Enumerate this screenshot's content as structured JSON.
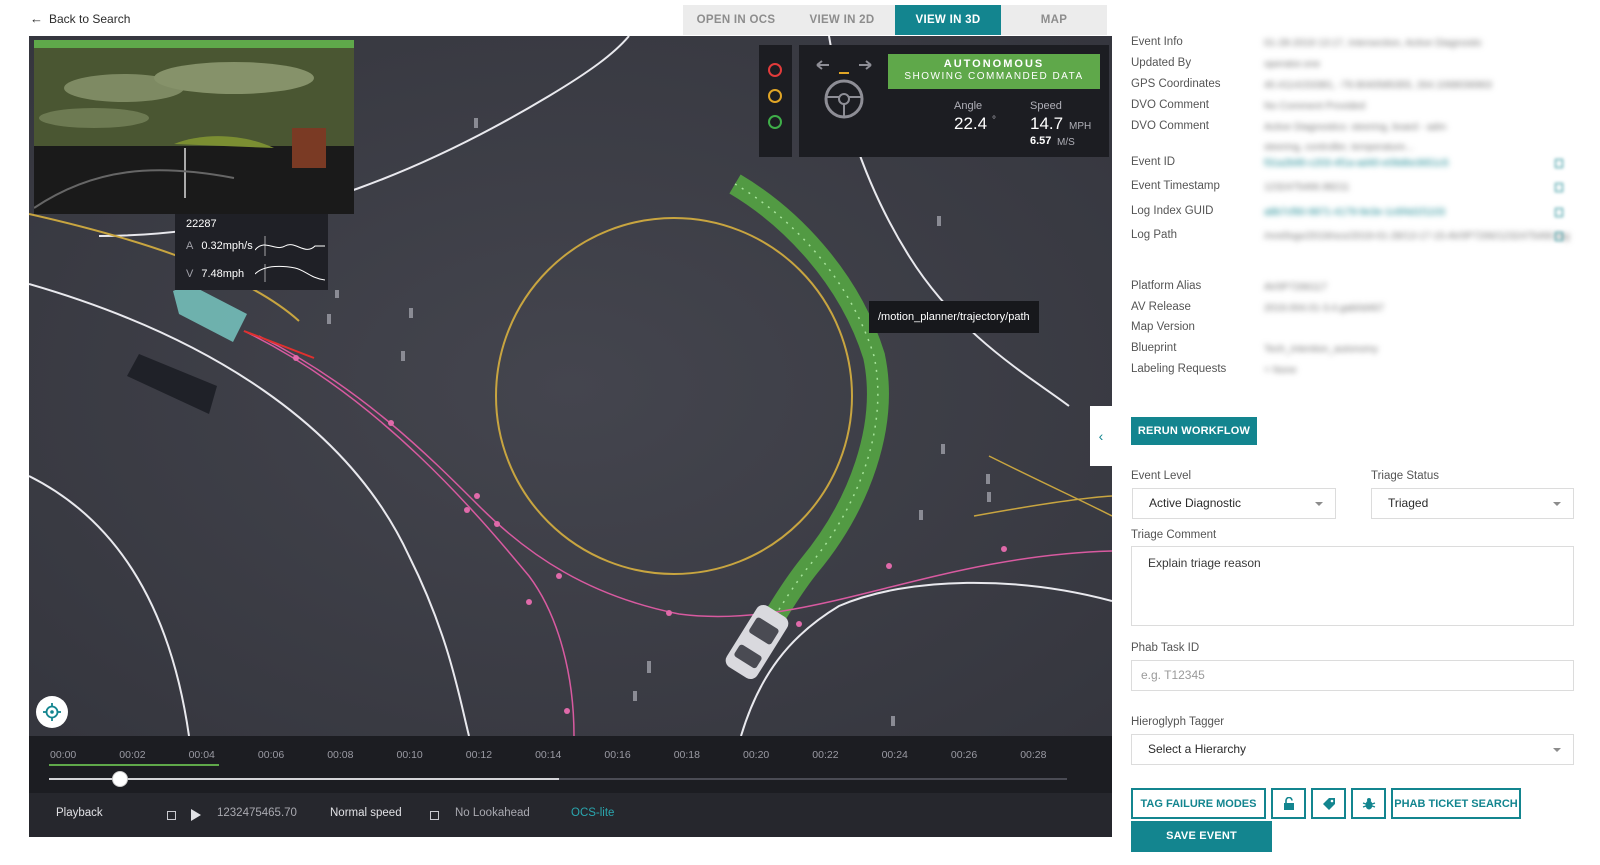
{
  "nav": {
    "back_label": "Back to Search",
    "tabs": [
      {
        "label": "OPEN IN OCS",
        "active": false
      },
      {
        "label": "VIEW IN 2D",
        "active": false
      },
      {
        "label": "VIEW IN 3D",
        "active": true
      },
      {
        "label": "MAP",
        "active": false
      }
    ]
  },
  "map": {
    "metrics": {
      "title": "22287",
      "accel_key": "A",
      "accel_value": "0.32mph/s",
      "velocity_key": "V",
      "velocity_value": "7.48mph"
    },
    "traffic_light": {
      "red": "#e23b3b",
      "yellow": "#e0a526",
      "green": "#3fae49"
    },
    "av_status": {
      "mode": "AUTONOMOUS",
      "mode_sub": "SHOWING COMMANDED DATA",
      "angle_label": "Angle",
      "angle_value": "22.4",
      "angle_unit": "°",
      "speed_label": "Speed",
      "speed_value": "14.7",
      "speed_unit": "MPH",
      "speed_ms": "6.57",
      "speed_ms_unit": "M/S"
    },
    "path_tooltip": "/motion_planner/trajectory/path",
    "collapse_icon": "chevron-left-icon",
    "locate_icon": "crosshair-icon"
  },
  "timeline": {
    "ticks": [
      "00:00",
      "00:02",
      "00:04",
      "00:06",
      "00:08",
      "00:10",
      "00:12",
      "00:14",
      "00:16",
      "00:18",
      "00:20",
      "00:22",
      "00:24",
      "00:26",
      "00:28"
    ]
  },
  "playbar": {
    "playback_label": "Playback",
    "timestamp": "1232475465.70",
    "speed_label": "Normal speed",
    "lookahead_label": "No Lookahead",
    "mode_label": "OCS-lite"
  },
  "event_info": {
    "rows": [
      {
        "label": "Event Info",
        "value": "01-28-2019 13:17, Intersection, Active Diagnostic"
      },
      {
        "label": "Updated By",
        "value": "operator.one"
      },
      {
        "label": "GPS Coordinates",
        "value": "40.4114153381, -79.9040585355, 264.1068036963"
      },
      {
        "label": "DVO Comment",
        "value": "No Comment Provided"
      },
      {
        "label": "DVO Comment",
        "value": "Active Diagnostics: steering, board - adm"
      },
      {
        "label": "Event ID",
        "value": "f31a2b95-c203-4f1a-ad40-e09d6e3651c5"
      },
      {
        "label": "Event Timestamp",
        "value": "1232475466.98211"
      },
      {
        "label": "Log Index GUID",
        "value": "a8b7cf90-9971-4179-9e3e-1c6f4d1f1103"
      },
      {
        "label": "Log Path",
        "value": "/mnt/logs/2019/ocs/2019-01-28/13-17-15-AV0P7266/1232475466.log"
      },
      {
        "label": "Platform Alias",
        "value": "AV0P7266117"
      },
      {
        "label": "AV Release",
        "value": "2019.004.01-3.4.gab0d467"
      },
      {
        "label": "Map Version",
        "value": ""
      },
      {
        "label": "Blueprint",
        "value": "Tech_intention_autonomy"
      },
      {
        "label": "Labeling Requests",
        "value": "+ None"
      }
    ],
    "dvo_comment_line2": "steering, controller, temperature..."
  },
  "actions": {
    "rerun_label": "RERUN WORKFLOW",
    "event_level_label": "Event Level",
    "event_level_value": "Active Diagnostic",
    "triage_status_label": "Triage Status",
    "triage_status_value": "Triaged",
    "triage_comment_label": "Triage Comment",
    "triage_comment_value": "Explain triage reason",
    "phab_task_label": "Phab Task ID",
    "phab_task_placeholder": "e.g. T12345",
    "hieroglyph_label": "Hieroglyph Tagger",
    "hieroglyph_value": "Select a Hierarchy",
    "tag_failure_label": "TAG FAILURE MODES",
    "phab_search_label": "PHAB TICKET SEARCH",
    "save_label": "SAVE EVENT",
    "icon_buttons": [
      "unlock-icon",
      "tag-icon",
      "bug-icon"
    ]
  }
}
